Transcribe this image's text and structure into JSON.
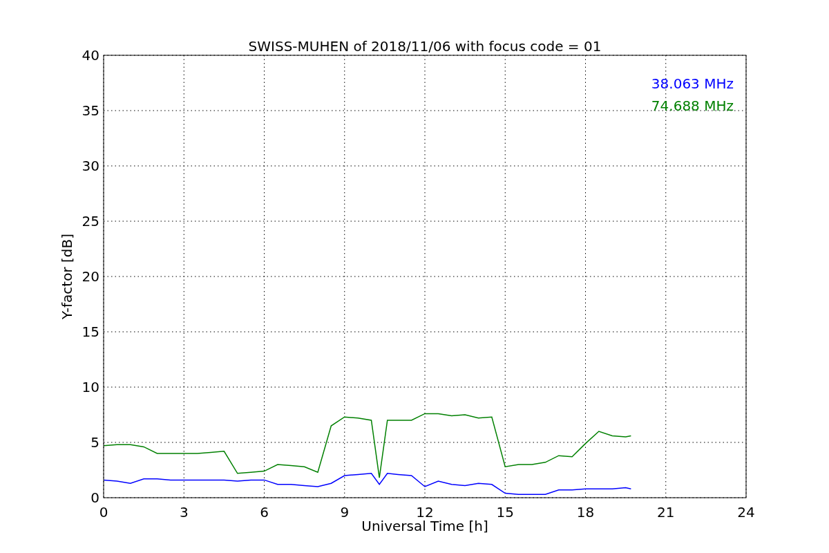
{
  "figure": {
    "chart_data": {
      "type": "line",
      "title": "SWISS-MUHEN of 2018/11/06 with focus code = 01",
      "xlabel": "Universal Time [h]",
      "ylabel": "Y-factor [dB]",
      "x": [
        0,
        0.5,
        1,
        1.5,
        2,
        2.5,
        3,
        3.5,
        4,
        4.5,
        5,
        5.5,
        6,
        6.5,
        7,
        7.5,
        8,
        8.5,
        9,
        9.5,
        10,
        10.3,
        10.6,
        11,
        11.5,
        12,
        12.5,
        13,
        13.5,
        14,
        14.5,
        15,
        15.5,
        16,
        16.5,
        17,
        17.5,
        18,
        18.5,
        19,
        19.5,
        19.7
      ],
      "series": [
        {
          "name": "38.063 MHz",
          "color": "#0000ff",
          "values": [
            1.6,
            1.5,
            1.3,
            1.7,
            1.7,
            1.6,
            1.6,
            1.6,
            1.6,
            1.6,
            1.5,
            1.6,
            1.6,
            1.2,
            1.2,
            1.1,
            1.0,
            1.3,
            2.0,
            2.1,
            2.2,
            1.2,
            2.2,
            2.1,
            2.0,
            1.0,
            1.5,
            1.2,
            1.1,
            1.3,
            1.2,
            0.4,
            0.3,
            0.3,
            0.3,
            0.7,
            0.7,
            0.8,
            0.8,
            0.8,
            0.9,
            0.8
          ]
        },
        {
          "name": "74.688 MHz",
          "color": "#008000",
          "values": [
            4.7,
            4.8,
            4.8,
            4.6,
            4.0,
            4.0,
            4.0,
            4.0,
            4.1,
            4.2,
            2.2,
            2.3,
            2.4,
            3.0,
            2.9,
            2.8,
            2.3,
            6.5,
            7.3,
            7.2,
            7.0,
            1.8,
            7.0,
            7.0,
            7.0,
            7.6,
            7.6,
            7.4,
            7.5,
            7.2,
            7.3,
            2.8,
            3.0,
            3.0,
            3.2,
            3.8,
            3.7,
            4.9,
            6.0,
            5.6,
            5.5,
            5.6
          ]
        }
      ],
      "xlim": [
        0,
        24
      ],
      "ylim": [
        0,
        40
      ],
      "xticks": [
        0,
        3,
        6,
        9,
        12,
        15,
        18,
        21,
        24
      ],
      "yticks": [
        0,
        5,
        10,
        15,
        20,
        25,
        30,
        35,
        40
      ],
      "grid": true
    }
  }
}
